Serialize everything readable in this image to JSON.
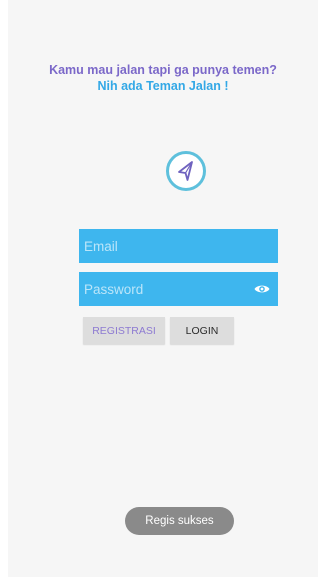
{
  "header": {
    "line1": "Kamu mau jalan tapi ga punya temen?",
    "line2": "Nih ada Teman Jalan !"
  },
  "logo": {
    "icon": "navigation-arrow-icon",
    "ring_color": "#5ec0dc"
  },
  "form": {
    "email_placeholder": "Email",
    "email_value": "",
    "password_placeholder": "Password",
    "password_value": "",
    "toggle_icon": "eye-icon",
    "field_color": "#3eb6ee"
  },
  "buttons": {
    "register": "REGISTRASI",
    "login": "LOGIN"
  },
  "toast": {
    "message": "Regis sukses"
  },
  "colors": {
    "headline_purple": "#7b68c9",
    "headline_blue": "#33a8e6"
  }
}
